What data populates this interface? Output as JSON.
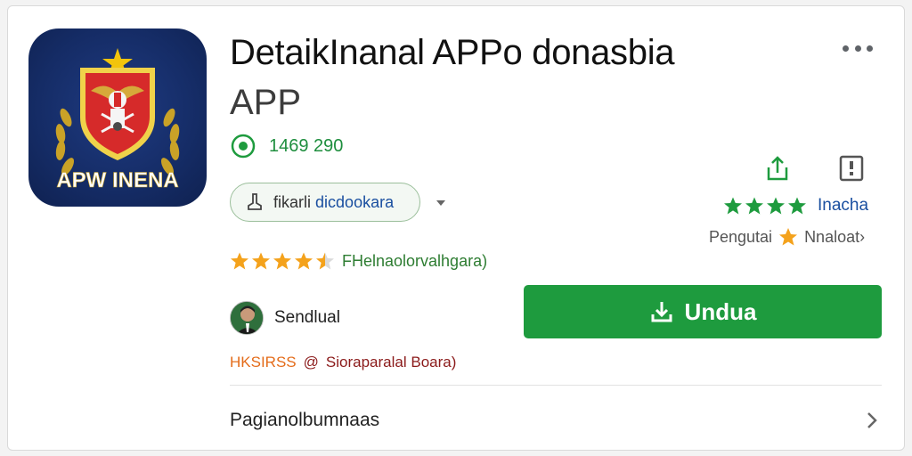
{
  "app": {
    "title": "DetaikInanal APPo donasbia",
    "subtitle": "APP",
    "icon_name": "app-emblem-icon",
    "icon_text": "APW INENA",
    "downloads": "1469 290"
  },
  "chip": {
    "prefix": "fikarli",
    "link": "dicdookara"
  },
  "rating": {
    "stars": 4.5,
    "label": "FHelnaolorvalhgara)"
  },
  "side": {
    "green_stars": 4,
    "green_label": "Inacha",
    "dev_prefix": "Pengutai",
    "dev_name": "Nnaloat›"
  },
  "seller": {
    "name": "Sendlual"
  },
  "install": {
    "label": "Undua"
  },
  "meta": {
    "tag": "HKSIRSS",
    "sep": "@",
    "text": "Sioraparalal Boara)"
  },
  "section": {
    "label": "Pagianolbumnaas"
  },
  "colors": {
    "green": "#1e9b3e",
    "star_orange": "#f4a21c",
    "link_blue": "#1a4fa0"
  }
}
